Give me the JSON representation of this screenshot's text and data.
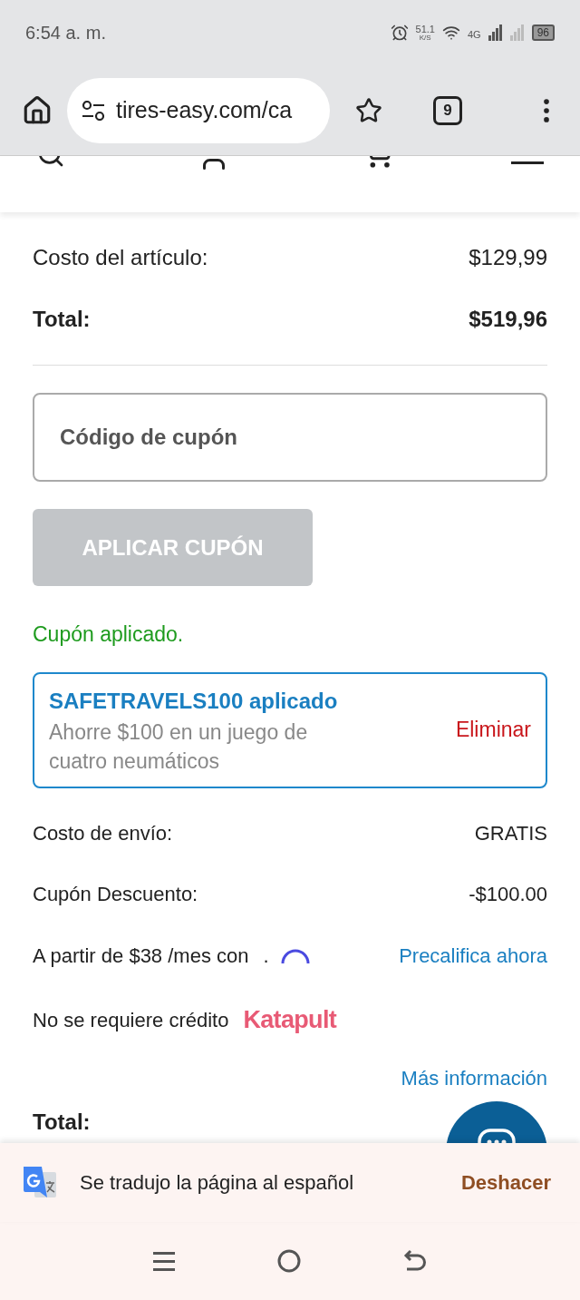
{
  "status_bar": {
    "time": "6:54 a. m.",
    "speed": "51.1",
    "speed_unit": "K/S",
    "network": "4G",
    "battery": "96"
  },
  "browser": {
    "url": "tires-easy.com/ca",
    "tab_count": "9"
  },
  "summary": [
    {
      "label": "Costo del artículo:",
      "value": "$129,99",
      "bold": false
    },
    {
      "label": "Total:",
      "value": "$519,96",
      "bold": true
    }
  ],
  "coupon": {
    "placeholder": "Código de cupón",
    "button": "APLICAR CUPÓN",
    "button_disabled": true,
    "message": "Cupón aplicado.",
    "applied_code": "SAFETRAVELS100 aplicado",
    "applied_description": "Ahorre $100 en un juego de cuatro neumáticos",
    "remove": "Eliminar"
  },
  "charges": [
    {
      "label": "Costo de envío:",
      "value": "GRATIS"
    },
    {
      "label": "Cupón Descuento:",
      "value": "-$100.00"
    }
  ],
  "financing": {
    "text": "A partir de $38 /mes con",
    "dot": ".",
    "link": "Precalifica ahora",
    "no_credit": "No se requiere crédito",
    "brand": "Katapult",
    "more_info": "Más información"
  },
  "total_partial": "Total:",
  "translate_bar": {
    "message": "Se tradujo la página al español",
    "action": "Deshacer"
  }
}
